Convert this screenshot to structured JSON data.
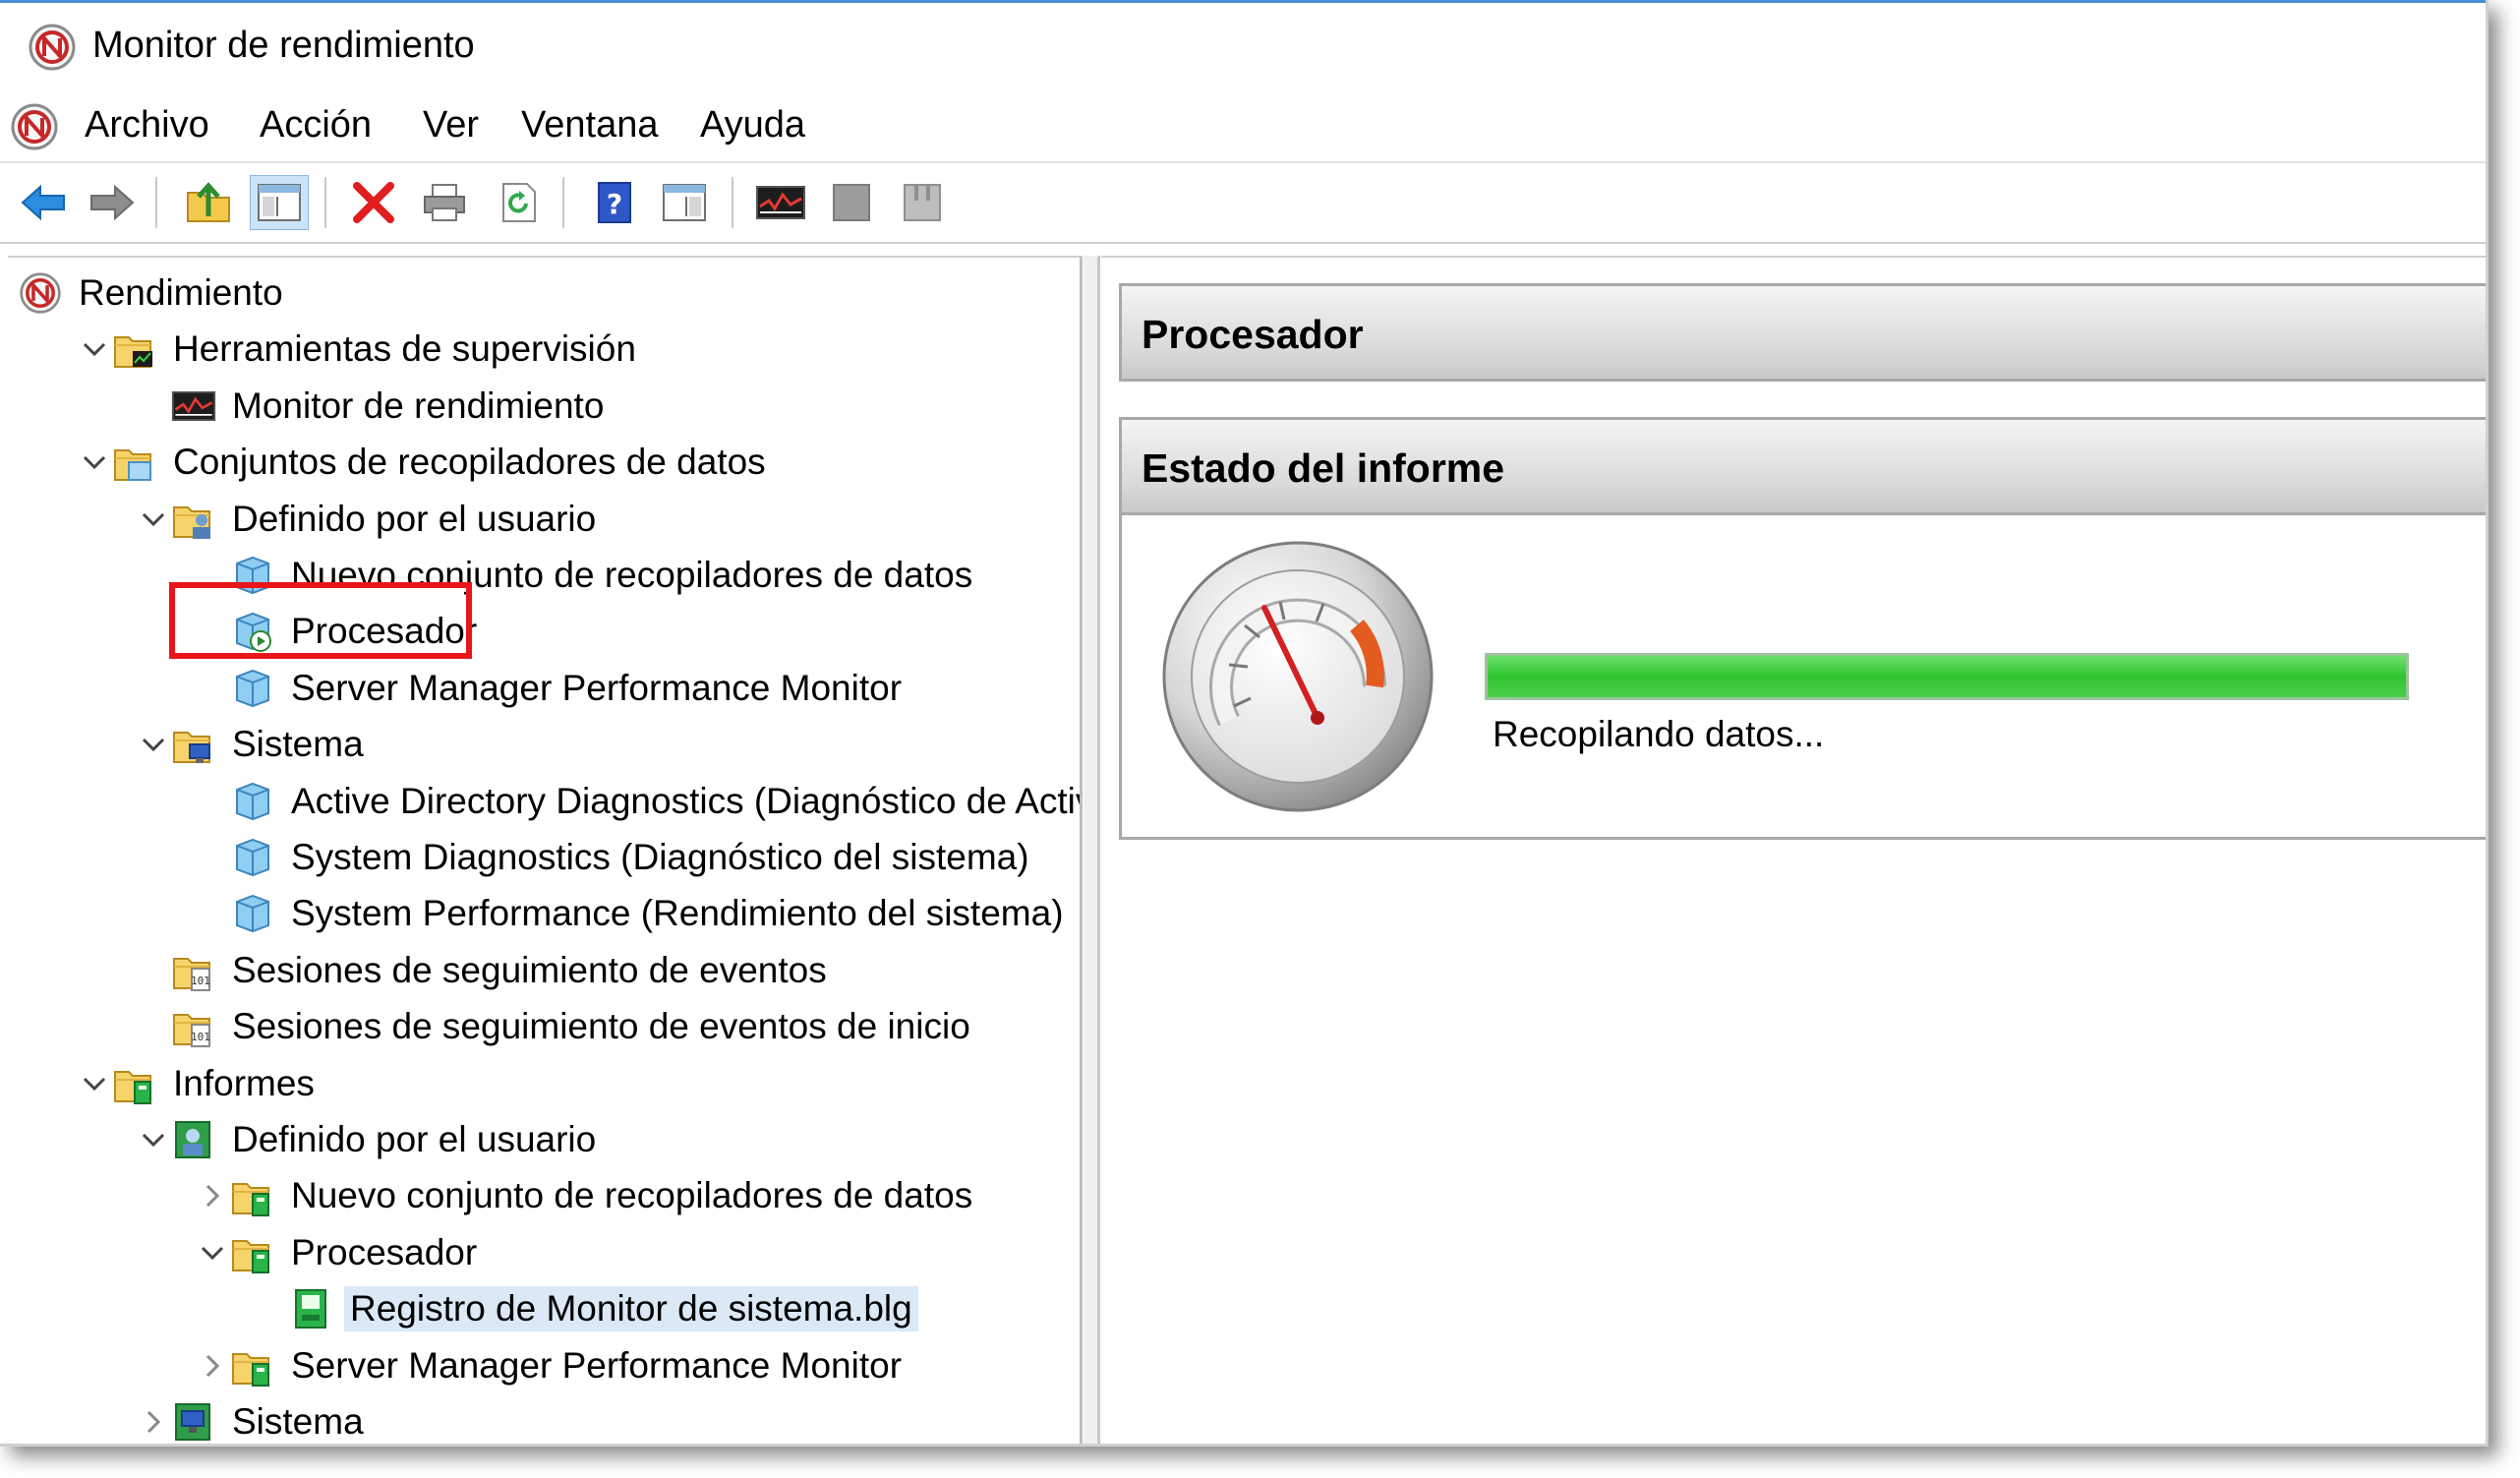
{
  "window": {
    "title": "Monitor de rendimiento"
  },
  "menu": {
    "items": [
      "Archivo",
      "Acción",
      "Ver",
      "Ventana",
      "Ayuda"
    ]
  },
  "toolbar": {
    "buttons": [
      {
        "icon": "back-arrow-icon"
      },
      {
        "icon": "forward-arrow-icon"
      },
      {
        "icon": "folder-up-icon"
      },
      {
        "icon": "show-hide-tree-icon",
        "pressed": true
      },
      {
        "icon": "delete-icon"
      },
      {
        "icon": "print-icon"
      },
      {
        "icon": "refresh-icon"
      },
      {
        "icon": "help-icon"
      },
      {
        "icon": "action-pane-icon"
      },
      {
        "icon": "performance-graph-icon"
      },
      {
        "icon": "stop-icon"
      },
      {
        "icon": "pause-icon"
      }
    ]
  },
  "tree": {
    "items": [
      {
        "label": "Rendimiento",
        "icon": "performance-root-icon",
        "expander": "none"
      },
      {
        "label": "Herramientas de supervisión",
        "icon": "monitoring-tools-folder-icon",
        "expander": "expanded"
      },
      {
        "label": "Monitor de rendimiento",
        "icon": "performance-monitor-icon",
        "expander": "none"
      },
      {
        "label": "Conjuntos de recopiladores de datos",
        "icon": "data-collector-sets-folder-icon",
        "expander": "expanded"
      },
      {
        "label": "Definido por el usuario",
        "icon": "user-defined-folder-icon",
        "expander": "expanded"
      },
      {
        "label": "Nuevo conjunto de recopiladores de datos",
        "icon": "data-collector-set-icon",
        "expander": "none"
      },
      {
        "label": "Procesador",
        "icon": "data-collector-set-running-icon",
        "expander": "none",
        "highlighted": true
      },
      {
        "label": "Server Manager Performance Monitor",
        "icon": "data-collector-set-icon",
        "expander": "none"
      },
      {
        "label": "Sistema",
        "icon": "system-folder-icon",
        "expander": "expanded"
      },
      {
        "label": "Active Directory Diagnostics (Diagnóstico de Activ",
        "icon": "data-collector-set-icon",
        "expander": "none"
      },
      {
        "label": "System Diagnostics (Diagnóstico del sistema)",
        "icon": "data-collector-set-icon",
        "expander": "none"
      },
      {
        "label": "System Performance (Rendimiento del sistema)",
        "icon": "data-collector-set-icon",
        "expander": "none"
      },
      {
        "label": "Sesiones de seguimiento de eventos",
        "icon": "event-trace-folder-icon",
        "expander": "none"
      },
      {
        "label": "Sesiones de seguimiento de eventos de inicio",
        "icon": "event-trace-folder-icon",
        "expander": "none"
      },
      {
        "label": "Informes",
        "icon": "reports-folder-icon",
        "expander": "expanded"
      },
      {
        "label": "Definido por el usuario",
        "icon": "user-defined-reports-icon",
        "expander": "expanded"
      },
      {
        "label": "Nuevo conjunto de recopiladores de datos",
        "icon": "report-folder-icon",
        "expander": "collapsed"
      },
      {
        "label": "Procesador",
        "icon": "report-folder-icon",
        "expander": "expanded"
      },
      {
        "label": "Registro de Monitor de sistema.blg",
        "icon": "log-file-icon",
        "expander": "none",
        "selected": true
      },
      {
        "label": "Server Manager Performance Monitor",
        "icon": "report-folder-icon",
        "expander": "collapsed"
      },
      {
        "label": "Sistema",
        "icon": "system-reports-icon",
        "expander": "collapsed"
      }
    ]
  },
  "details": {
    "header_title": "Procesador",
    "report_header": "Estado del informe",
    "status_text": "Recopilando datos...",
    "progress_fraction": 1.0,
    "gauge_icon": "speedometer-icon"
  },
  "colors": {
    "highlight_box": "#e8161b",
    "progress_green": "#2fc42f",
    "title_accent": "#4a8fd6"
  }
}
